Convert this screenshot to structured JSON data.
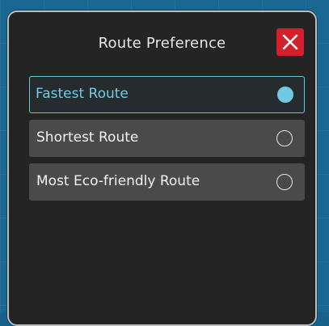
{
  "dialog": {
    "title": "Route Preference",
    "close_icon": "close-icon",
    "accent_color": "#6fcce6",
    "close_color": "#d3202a"
  },
  "options": [
    {
      "label": "Fastest Route",
      "selected": true
    },
    {
      "label": "Shortest Route",
      "selected": false
    },
    {
      "label": "Most Eco-friendly Route",
      "selected": false
    }
  ]
}
